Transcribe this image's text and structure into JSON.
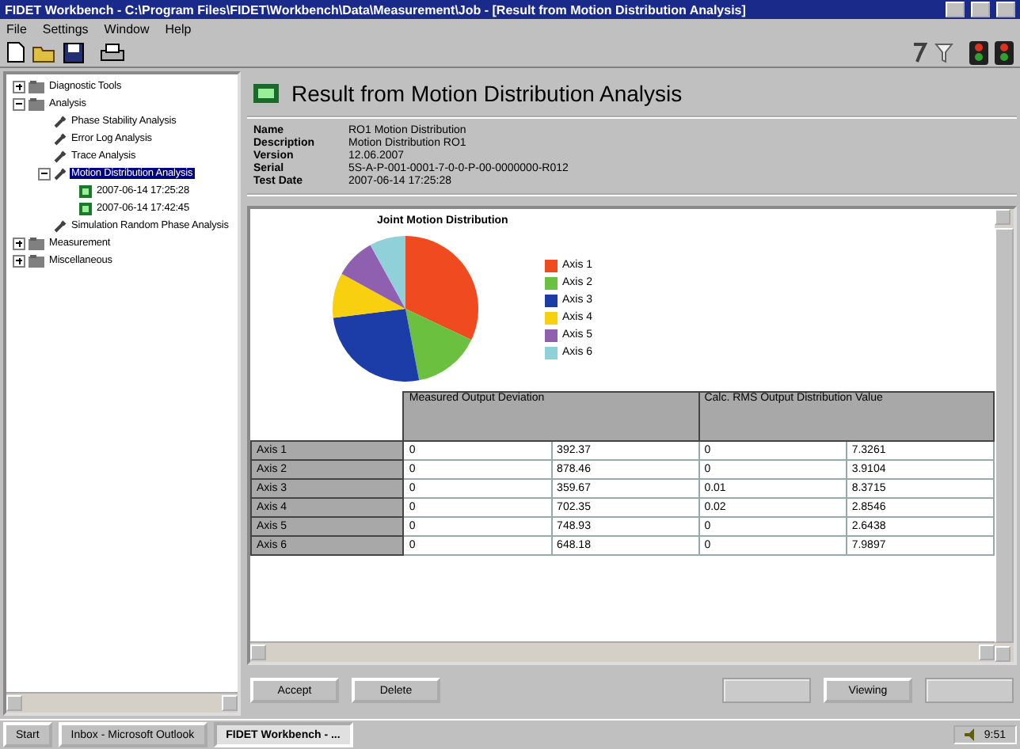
{
  "window": {
    "title": "FIDET Workbench - C:\\Program Files\\FIDET\\Workbench\\Data\\Measurement\\Job - [Result from Motion Distribution Analysis]"
  },
  "menu": [
    "File",
    "Settings",
    "Window",
    "Help"
  ],
  "tree": [
    {
      "label": "Diagnostic Tools",
      "expanded": false,
      "selected": false,
      "kind": "folder"
    },
    {
      "label": "Analysis",
      "expanded": true,
      "selected": false,
      "kind": "folder",
      "children": [
        {
          "label": "Phase Stability Analysis",
          "selected": false,
          "kind": "tool"
        },
        {
          "label": "Error Log Analysis",
          "selected": false,
          "kind": "tool"
        },
        {
          "label": "Trace Analysis",
          "selected": false,
          "kind": "tool"
        },
        {
          "label": "Motion Distribution Analysis",
          "expanded": true,
          "selected": true,
          "kind": "tool",
          "children": [
            {
              "label": "2007-06-14 17:25:28",
              "selected": false,
              "kind": "result"
            },
            {
              "label": "2007-06-14 17:42:45",
              "selected": false,
              "kind": "result"
            }
          ]
        },
        {
          "label": "Simulation Random Phase Analysis",
          "selected": false,
          "kind": "tool"
        }
      ]
    },
    {
      "label": "Measurement",
      "expanded": false,
      "selected": false,
      "kind": "folder"
    },
    {
      "label": "Miscellaneous",
      "expanded": false,
      "selected": false,
      "kind": "folder"
    }
  ],
  "header": {
    "title": "Result from Motion Distribution Analysis"
  },
  "info": [
    {
      "label": "Name",
      "value": "RO1 Motion Distribution"
    },
    {
      "label": "Description",
      "value": "Motion Distribution RO1"
    },
    {
      "label": "Version",
      "value": "12.06.2007"
    },
    {
      "label": "Serial",
      "value": "5S-A-P-001-0001-7-0-0-P-00-0000000-R012"
    },
    {
      "label": "Test Date",
      "value": "2007-06-14 17:25:28"
    }
  ],
  "chart": {
    "title": "Joint Motion Distribution",
    "legend": [
      {
        "label": "Axis 1",
        "color": "#f04a20"
      },
      {
        "label": "Axis 2",
        "color": "#6cc040"
      },
      {
        "label": "Axis 3",
        "color": "#1c3ca8"
      },
      {
        "label": "Axis 4",
        "color": "#f8d010"
      },
      {
        "label": "Axis 5",
        "color": "#9060b0"
      },
      {
        "label": "Axis 6",
        "color": "#90d0d8"
      }
    ]
  },
  "table": {
    "columns": [
      {
        "label": "Measured Output Deviation",
        "colspan": 2
      },
      {
        "label": "Calc. RMS Output Distribution Value",
        "colspan": 2
      }
    ],
    "rows": [
      {
        "name": "Axis 1",
        "cells": [
          "0",
          "392.37",
          "0",
          "7.3261"
        ]
      },
      {
        "name": "Axis 2",
        "cells": [
          "0",
          "878.46",
          "0",
          "3.9104"
        ]
      },
      {
        "name": "Axis 3",
        "cells": [
          "0",
          "359.67",
          "0.01",
          "8.3715"
        ]
      },
      {
        "name": "Axis 4",
        "cells": [
          "0",
          "702.35",
          "0.02",
          "2.8546"
        ]
      },
      {
        "name": "Axis 5",
        "cells": [
          "0",
          "748.93",
          "0",
          "2.6438"
        ]
      },
      {
        "name": "Axis 6",
        "cells": [
          "0",
          "648.18",
          "0",
          "7.9897"
        ]
      }
    ]
  },
  "buttons_left": [
    {
      "label": "Accept",
      "disabled": false
    },
    {
      "label": "Delete",
      "disabled": false
    }
  ],
  "buttons_right": [
    {
      "disabled": true
    },
    {
      "label": "Viewing",
      "disabled": false
    },
    {
      "disabled": true
    }
  ],
  "taskbar": {
    "start": "Start",
    "tasks": [
      {
        "label": "Inbox - Microsoft Outlook",
        "selected": false
      },
      {
        "label": "FIDET Workbench - ...",
        "selected": true
      }
    ],
    "clock": "9:51"
  }
}
